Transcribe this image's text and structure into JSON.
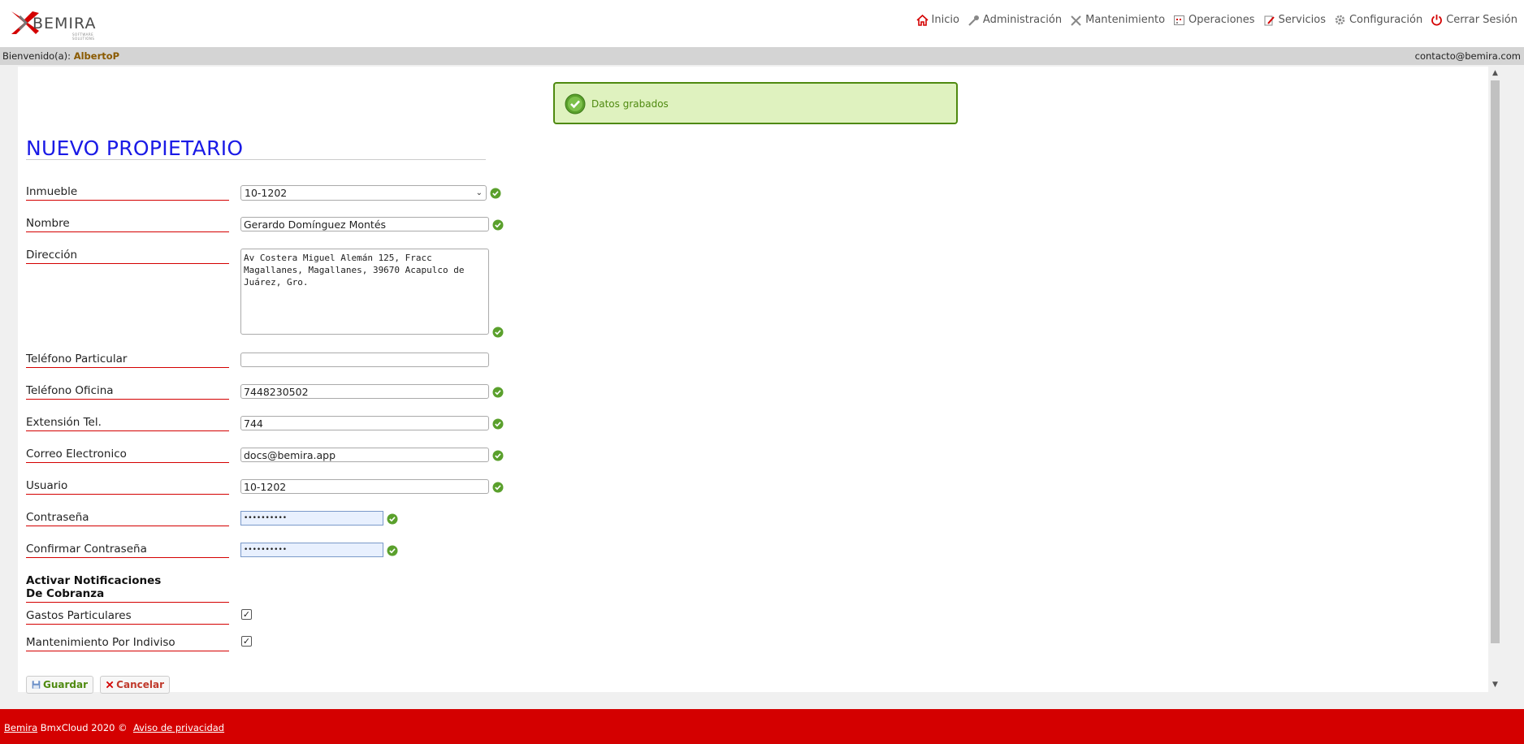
{
  "header": {
    "logo_text": "BEMIRA",
    "logo_subtitle": "SOFTWARE SOLUTIONS",
    "nav": [
      {
        "label": "Inicio",
        "icon": "home-icon"
      },
      {
        "label": "Administración",
        "icon": "key-icon"
      },
      {
        "label": "Mantenimiento",
        "icon": "tools-icon"
      },
      {
        "label": "Operaciones",
        "icon": "calendar-icon"
      },
      {
        "label": "Servicios",
        "icon": "pencil-icon"
      },
      {
        "label": "Configuración",
        "icon": "gear-icon"
      },
      {
        "label": "Cerrar Sesión",
        "icon": "power-icon"
      }
    ]
  },
  "welcome": {
    "prefix": "Bienvenido(a):",
    "user": "AlbertoP",
    "contact": "contacto@bemira.com"
  },
  "message": {
    "text": "Datos grabados",
    "color": "#4f8a10"
  },
  "form": {
    "title": "NUEVO PROPIETARIO",
    "inmueble": {
      "label": "Inmueble",
      "value": "10-1202"
    },
    "nombre": {
      "label": "Nombre",
      "value": "Gerardo Domínguez Montés"
    },
    "direccion": {
      "label": "Dirección",
      "value": "Av Costera Miguel Alemán 125, Fracc Magallanes, Magallanes, 39670 Acapulco de Juárez, Gro."
    },
    "telefono_particular": {
      "label": "Teléfono Particular",
      "value": ""
    },
    "telefono_oficina": {
      "label": "Teléfono Oficina",
      "value": "7448230502"
    },
    "extension": {
      "label": "Extensión Tel.",
      "value": "744"
    },
    "correo": {
      "label": "Correo Electronico",
      "value": "docs@bemira.app"
    },
    "usuario": {
      "label": "Usuario",
      "value": "10-1202"
    },
    "contrasena": {
      "label": "Contraseña",
      "value": "••••••••••"
    },
    "confirmar": {
      "label": "Confirmar Contraseña",
      "value": "••••••••••"
    },
    "notificaciones": {
      "label": "Activar Notificaciones De Cobranza"
    },
    "gastos": {
      "label": "Gastos Particulares",
      "checked": true
    },
    "mantenimiento": {
      "label": "Mantenimiento Por Indiviso",
      "checked": true
    },
    "guardar_label": "Guardar",
    "cancelar_label": "Cancelar"
  },
  "footer": {
    "brand": "Bemira",
    "text": "BmxCloud 2020 ©",
    "privacy": "Aviso de privacidad"
  },
  "colors": {
    "accent_red": "#d40000",
    "title_blue": "#1a1ae6",
    "success_green": "#4f8a10"
  }
}
